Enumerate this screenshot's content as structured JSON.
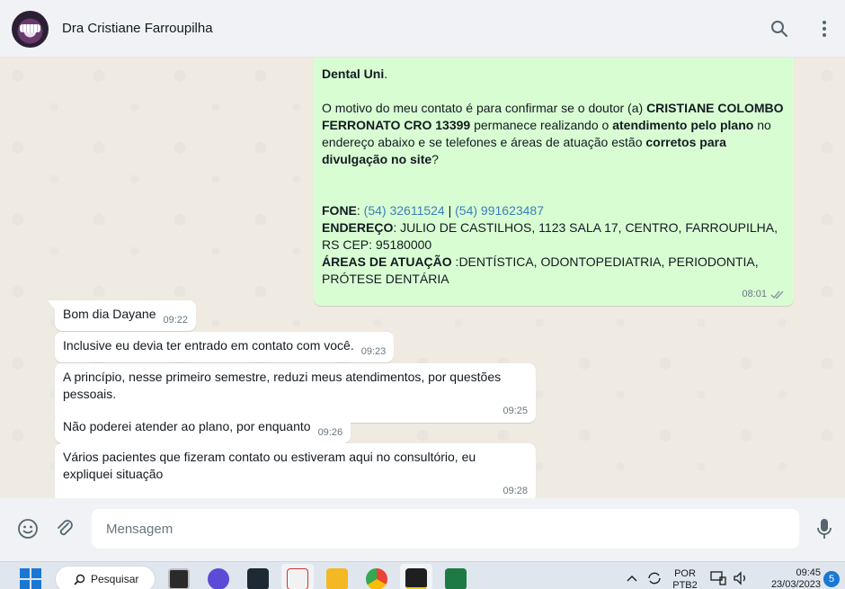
{
  "header": {
    "contact_name": "Dra Cristiane Farroupilha"
  },
  "outgoing": {
    "partial_line": "Dental Uni",
    "partial_suffix": ".",
    "para1_a": "O motivo do meu contato é para confirmar se o doutor (a) ",
    "para1_b": "CRISTIANE COLOMBO FERRONATO  CRO 13399",
    "para1_c": " permanece realizando o ",
    "para1_d": "atendimento pelo plano",
    "para1_e": " no endereço abaixo e se telefones e áreas de atuação estão ",
    "para1_f": "corretos para divulgação no site",
    "para1_g": "?",
    "fone_label": "FONE",
    "phone1": "(54) 32611524",
    "phone_sep": " | ",
    "phone2": "(54) 991623487",
    "endereco_label": "ENDEREÇO",
    "endereco_value": " JULIO DE CASTILHOS, 1123 SALA 17, CENTRO, FARROUPILHA, RS CEP: 95180000",
    "areas_label": "ÁREAS DE ATUAÇÃO",
    "areas_value": " :DENTÍSTICA, ODONTOPEDIATRIA, PERIODONTIA, PRÓTESE DENTÁRIA",
    "time": "08:01"
  },
  "incoming": [
    {
      "text": "Bom dia Dayane",
      "time": "09:22"
    },
    {
      "text": "Inclusive eu devia ter entrado em contato com você.",
      "time": "09:23"
    },
    {
      "text": "A princípio, nesse primeiro semestre, reduzi meus atendimentos, por questões pessoais.",
      "time": "09:25"
    },
    {
      "text": "Não poderei atender ao plano, por enquanto",
      "time": "09:26"
    },
    {
      "text": "Vários pacientes que fizeram contato ou estiveram aqui no consultório, eu expliquei situação",
      "time": "09:28"
    }
  ],
  "composer": {
    "placeholder": "Mensagem"
  },
  "taskbar": {
    "search_label": "Pesquisar",
    "lang_top": "POR",
    "lang_bottom": "PTB2",
    "time": "09:45",
    "date": "23/03/2023",
    "notifications": "5"
  },
  "colors": {
    "outgoing_bubble": "#d9fdd3",
    "link": "#3b7fb8",
    "chat_bg": "#efeae2"
  }
}
